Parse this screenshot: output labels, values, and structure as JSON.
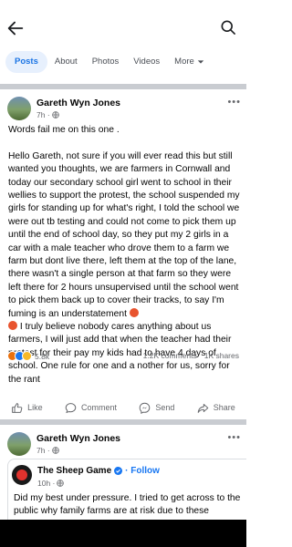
{
  "header": {
    "back_icon": "arrow-left-icon",
    "search_icon": "search-icon"
  },
  "tabs": [
    {
      "label": "Posts",
      "active": true
    },
    {
      "label": "About"
    },
    {
      "label": "Photos"
    },
    {
      "label": "Videos"
    },
    {
      "label": "More"
    }
  ],
  "post1": {
    "author": "Gareth Wyn Jones",
    "time": "7h ·",
    "text_intro": "Words fail me on this one .",
    "text_body_1": "Hello Gareth, not sure if you will ever read this but still wanted you thoughts, we are farmers in Cornwall and today our secondary school girl went to school in their wellies to support the protest, the school suspended my girls for standing up for what's right, I told the school we were out tb testing and could not come to pick them up until the end of school day, so they put my 2 girls in a car with a male teacher who drove them to a farm we farm but dont live there, left them at the top of the lane, there wasn't a single person at that farm so they were left there for 2 hours unsupervised until the school went to pick them back up to cover their tracks, to say I'm fuming is an understatement",
    "text_body_2": "I truly believe nobody cares anything about us farmers, I will just add that when the teacher had their protest for their pay my kids had to have 4 days of school. One rule for one and a nother for us, sorry for the rant",
    "reaction_count": "5.8k",
    "comments": "1.2K comments",
    "shares": "1K shares",
    "actions": {
      "like": "Like",
      "comment": "Comment",
      "send": "Send",
      "share": "Share"
    }
  },
  "post2": {
    "author": "Gareth Wyn Jones",
    "time": "7h ·",
    "shared_page": "The Sheep Game",
    "follow": "· Follow",
    "shared_time": "10h ·",
    "shared_text": "Did my best under pressure.  I tried to get across to the public why family farms are at risk due to these"
  },
  "colors": {
    "accent": "#1877f2",
    "tab_active_bg": "#e7f0fd",
    "divider": "#c9ccd1"
  }
}
